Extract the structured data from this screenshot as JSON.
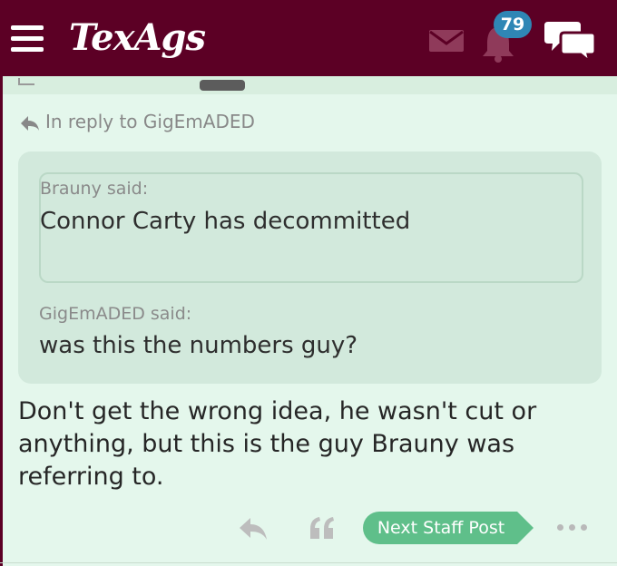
{
  "header": {
    "logo_text": "TexAgs",
    "notification_count": "79",
    "colors": {
      "bar": "#5c0025",
      "badge": "#2f86b5"
    },
    "icons": [
      "menu-icon",
      "mail-icon",
      "bell-icon",
      "chat-icon"
    ]
  },
  "post": {
    "reply_to": "In reply to GigEmADED",
    "nested_quote": {
      "author": "Brauny said:",
      "text": "Connor Carty has decommitted"
    },
    "quote": {
      "author": "GigEmADED said:",
      "text": "was this the numbers guy?"
    },
    "body": "Don't get the wrong idea, he wasn't cut or anything, but this is the guy Brauny was referring to."
  },
  "actions": {
    "next_staff_post": "Next Staff Post",
    "icons": [
      "reply-icon",
      "quote-icon",
      "more-icon"
    ],
    "accent": "#5fbf8a"
  }
}
